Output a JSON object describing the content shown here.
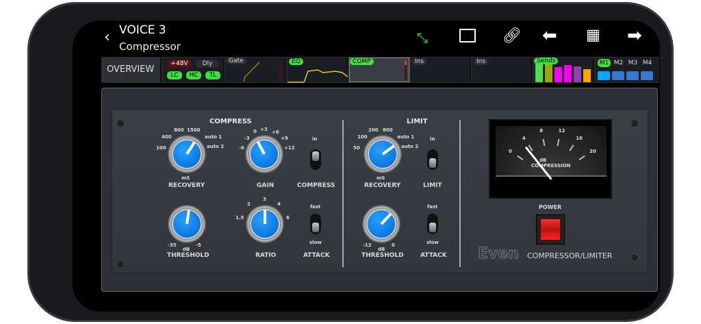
{
  "header": {
    "title": "VOICE 3",
    "subtitle": "Compressor"
  },
  "toolbar": {
    "icons": [
      "back-chevron-icon",
      "fullscreen-icon",
      "folder-icon",
      "link-icon",
      "previous-arrow-icon",
      "grid-icon",
      "next-arrow-icon"
    ],
    "accent": "#3ee03e"
  },
  "strip": {
    "overview": "OVERVIEW",
    "phantom": "+48V",
    "delay": "Dly",
    "lc": "LC",
    "hc": "HC",
    "tl": "TL",
    "gate": "Gate",
    "eq": "EQ",
    "comp": "COMP",
    "ins1": "Ins",
    "ins2": "Ins",
    "sends": "Sends",
    "send_levels": [
      {
        "color": "#4ee04e",
        "level": 0.9
      },
      {
        "color": "#9aab00",
        "level": 0.9
      },
      {
        "color": "#ff00ff",
        "level": 0.7
      },
      {
        "color": "#ff00ee",
        "level": 0.8
      },
      {
        "color": "#8e44ad",
        "level": 0.75
      },
      {
        "color": "#ffa500",
        "level": 0.6
      }
    ],
    "mixes": [
      "M1",
      "M2",
      "M3",
      "M4"
    ]
  },
  "compress": {
    "title": "COMPRESS",
    "recovery": {
      "label": "RECOVERY",
      "unit": "mS",
      "scale": [
        "100",
        "400",
        "800",
        "1500",
        "auto 1",
        "auto 2"
      ],
      "position": 0.62
    },
    "gain": {
      "label": "GAIN",
      "scale": [
        "-6",
        "-3",
        "0",
        "+3",
        "+6",
        "+9",
        "+12"
      ],
      "position": 0.4
    },
    "switch": {
      "label": "COMPRESS",
      "top": "in",
      "state": "in"
    },
    "threshold": {
      "label": "THRESHOLD",
      "unit": "dB",
      "min": "-35",
      "max": "-5",
      "position": 0.53
    },
    "ratio": {
      "label": "RATIO",
      "scale": [
        "1.5",
        "2",
        "3",
        "4",
        "6"
      ],
      "position": 0.5
    },
    "attack": {
      "label": "ATTACK",
      "top": "fast",
      "bottom": "slow",
      "state": "slow"
    }
  },
  "limit": {
    "title": "LIMIT",
    "recovery": {
      "label": "RECOVERY",
      "unit": "mS",
      "scale": [
        "50",
        "100",
        "200",
        "800",
        "auto 1",
        "auto 2"
      ],
      "position": 0.7
    },
    "switch": {
      "label": "LIMIT",
      "top": "in",
      "state": "in"
    },
    "threshold": {
      "label": "THRESHOLD",
      "unit": "dB",
      "min": "-12",
      "max": "0",
      "position": 0.66
    },
    "attack": {
      "label": "ATTACK",
      "top": "fast",
      "bottom": "slow",
      "state": "slow"
    }
  },
  "meter": {
    "scale": [
      "0",
      "4",
      "8",
      "12",
      "16",
      "20"
    ],
    "unit": "dB",
    "label": "COMPRESSION",
    "value": 3
  },
  "power": {
    "label": "POWER"
  },
  "brand": {
    "logo": "Even",
    "name": "COMPRESSOR/LIMITER"
  }
}
